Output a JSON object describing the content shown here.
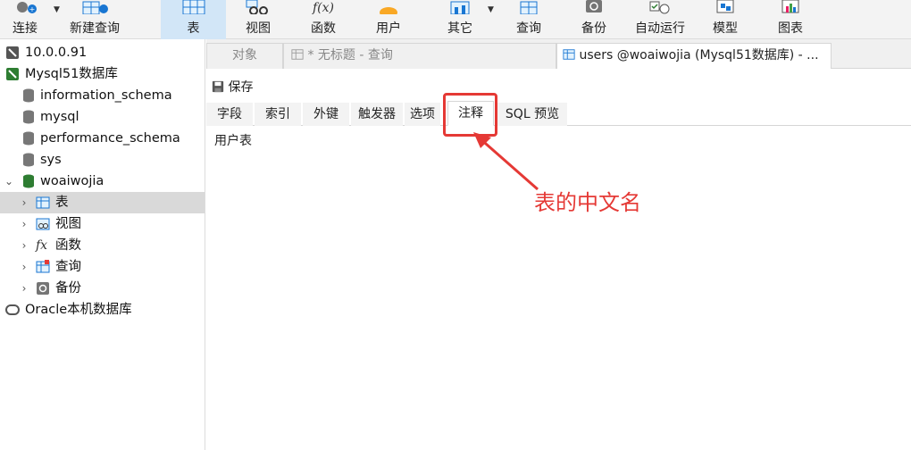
{
  "toolbar": {
    "items": [
      {
        "label": "连接",
        "icon": "plug-icon"
      },
      {
        "label": "新建查询",
        "icon": "new-query-icon"
      },
      {
        "label": "表",
        "icon": "table-icon",
        "active": true
      },
      {
        "label": "视图",
        "icon": "view-icon"
      },
      {
        "label": "函数",
        "icon": "function-icon",
        "glyph": "f(x)"
      },
      {
        "label": "用户",
        "icon": "user-icon"
      },
      {
        "label": "其它",
        "icon": "other-icon"
      },
      {
        "label": "查询",
        "icon": "query-icon"
      },
      {
        "label": "备份",
        "icon": "backup-icon"
      },
      {
        "label": "自动运行",
        "icon": "schedule-icon"
      },
      {
        "label": "模型",
        "icon": "model-icon"
      },
      {
        "label": "图表",
        "icon": "chart-icon"
      }
    ],
    "dropdown_glyph": "▼"
  },
  "sidebar": {
    "items": [
      {
        "label": "10.0.0.91"
      },
      {
        "label": "Mysql51数据库"
      },
      {
        "label": "information_schema"
      },
      {
        "label": "mysql"
      },
      {
        "label": "performance_schema"
      },
      {
        "label": "sys"
      },
      {
        "label": "woaiwojia",
        "chevron": "⌄"
      },
      {
        "label": "表",
        "chevron": "›"
      },
      {
        "label": "视图",
        "chevron": "›"
      },
      {
        "label": "函数",
        "chevron": "›",
        "glyph": "fx"
      },
      {
        "label": "查询",
        "chevron": "›"
      },
      {
        "label": "备份",
        "chevron": "›"
      },
      {
        "label": "Oracle本机数据库"
      }
    ]
  },
  "tabs": {
    "objects": "对象",
    "untitled_query": "* 无标题 - 查询",
    "users_table": "users @woaiwojia (Mysql51数据库) - ..."
  },
  "editor": {
    "save_label": "保存",
    "subtabs": [
      "字段",
      "索引",
      "外键",
      "触发器",
      "选项",
      "注释",
      "SQL 预览"
    ],
    "comment_text": "用户表"
  },
  "annotation": {
    "text": "表的中文名",
    "color": "#e53935"
  },
  "colors": {
    "accent": "#2e7d32",
    "active_toolbar": "#d2e6f7",
    "selected_row": "#d9d9d9"
  }
}
